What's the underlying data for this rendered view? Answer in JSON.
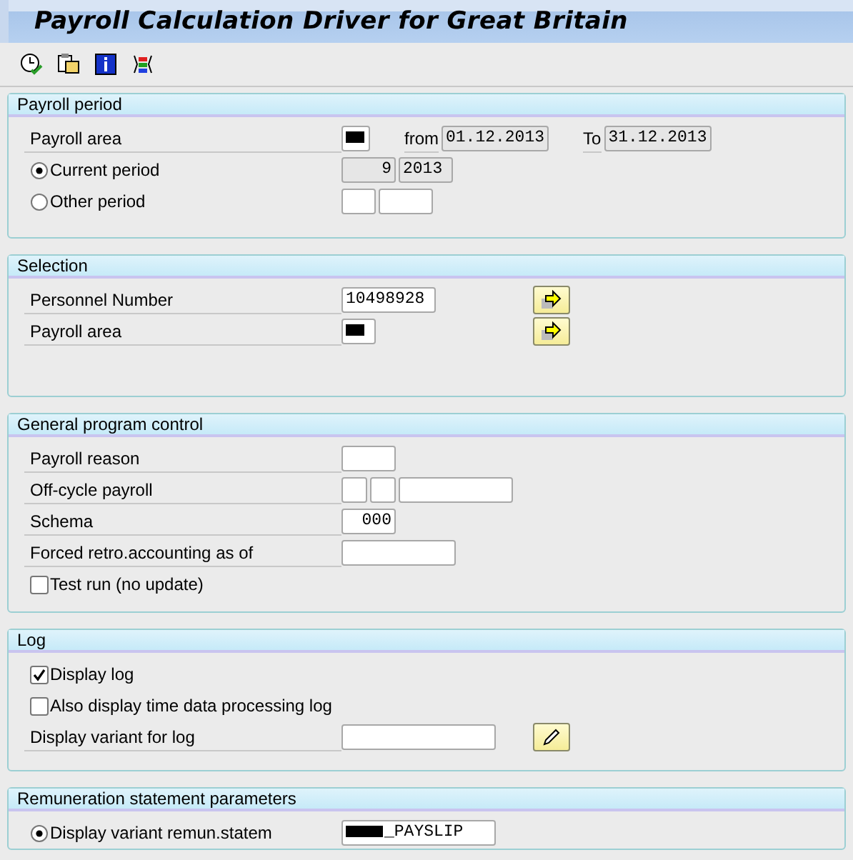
{
  "window": {
    "title": "Payroll Calculation Driver for Great Britain"
  },
  "toolbar": [
    {
      "kind": "tool"
    },
    {
      "kind": "tool"
    },
    {
      "kind": "tool"
    },
    {
      "kind": "tool"
    }
  ],
  "sections": [
    {
      "title": "Payroll period",
      "rows": [
        {
          "kind": "field",
          "label": "Payroll area",
          "parts": [
            {
              "kind": "input",
              "redacted": true,
              "readonly": false
            },
            {
              "kind": "text",
              "text": "from"
            },
            {
              "kind": "input",
              "value": "01.12.2013",
              "readonly": true
            },
            {
              "kind": "text",
              "text": "To"
            },
            {
              "kind": "input",
              "value": "31.12.2013",
              "readonly": true
            }
          ]
        },
        {
          "kind": "radio",
          "label": "Current period",
          "selected": true,
          "parts": [
            {
              "kind": "input",
              "value": "9",
              "readonly": true
            },
            {
              "kind": "input",
              "value": "2013",
              "readonly": true
            }
          ]
        },
        {
          "kind": "radio",
          "label": "Other period",
          "selected": false,
          "parts": [
            {
              "kind": "input",
              "readonly": false
            },
            {
              "kind": "input",
              "readonly": false
            }
          ]
        }
      ]
    },
    {
      "title": "Selection",
      "rows": [
        {
          "kind": "lookup",
          "label": "Personnel Number",
          "parts": [
            {
              "kind": "input",
              "value": "10498928",
              "readonly": false
            }
          ]
        },
        {
          "kind": "lookup",
          "label": "Payroll area",
          "parts": [
            {
              "kind": "input",
              "redacted": true,
              "readonly": false
            }
          ]
        }
      ]
    },
    {
      "title": "General program control",
      "rows": [
        {
          "kind": "field",
          "label": "Payroll reason",
          "parts": [
            {
              "kind": "input",
              "readonly": false
            }
          ]
        },
        {
          "kind": "field",
          "label": "Off-cycle payroll",
          "parts": [
            {
              "kind": "input",
              "readonly": false
            },
            {
              "kind": "input",
              "readonly": false
            },
            {
              "kind": "input",
              "readonly": false
            }
          ]
        },
        {
          "kind": "field",
          "label": "Schema",
          "parts": [
            {
              "kind": "input",
              "value": "000",
              "readonly": false
            }
          ]
        },
        {
          "kind": "field",
          "label": "Forced retro.accounting as of",
          "parts": [
            {
              "kind": "input",
              "readonly": false
            }
          ]
        },
        {
          "kind": "checkbox",
          "label": "Test run (no update)",
          "checked": false
        }
      ]
    },
    {
      "title": "Log",
      "rows": [
        {
          "kind": "checkbox",
          "label": "Display log",
          "checked": true
        },
        {
          "kind": "checkbox",
          "label": "Also display time data processing log",
          "checked": false
        },
        {
          "kind": "variant",
          "label": "Display variant for log",
          "parts": [
            {
              "kind": "input",
              "readonly": false
            }
          ]
        }
      ]
    },
    {
      "title": "Remuneration statement parameters",
      "rows": [
        {
          "kind": "radio",
          "label": "Display variant remun.statem",
          "selected": true,
          "parts": [
            {
              "kind": "input",
              "value": "_PAYSLIP",
              "redacted": true,
              "readonly": false
            }
          ]
        }
      ]
    }
  ]
}
